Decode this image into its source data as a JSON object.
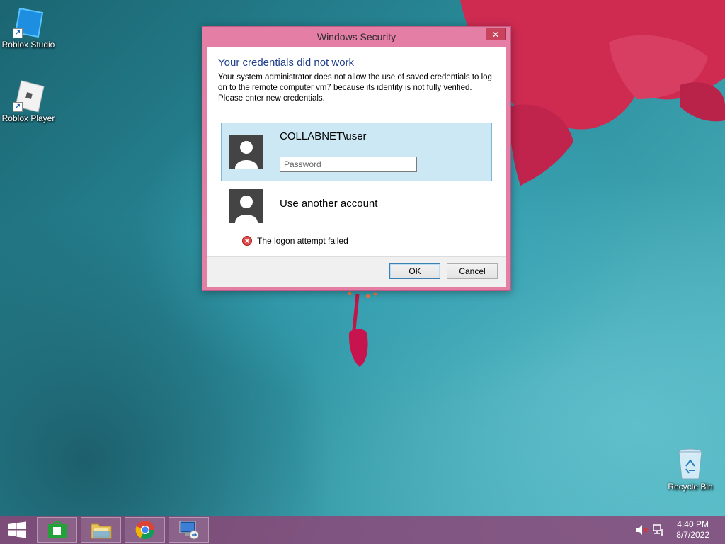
{
  "desktop": {
    "icons": [
      {
        "label": "Roblox Studio"
      },
      {
        "label": "Roblox Player"
      },
      {
        "label": "Recycle Bin"
      }
    ]
  },
  "dialog": {
    "title": "Windows Security",
    "close_label": "✕",
    "heading": "Your credentials did not work",
    "description": "Your system administrator does not allow the use of saved credentials to log on to the remote computer vm7 because its identity is not fully verified. Please enter new credentials.",
    "selected_account": "COLLABNET\\user",
    "password_placeholder": "Password",
    "other_account": "Use another account",
    "error_message": "The logon attempt failed",
    "ok_label": "OK",
    "cancel_label": "Cancel"
  },
  "taskbar": {
    "items": [
      "windows-store",
      "file-explorer",
      "chrome",
      "remote-desktop-connection"
    ],
    "time": "4:40 PM",
    "date": "8/7/2022"
  },
  "colors": {
    "dialog_frame": "#e57ea4",
    "heading": "#1f3f8c",
    "selected_tile": "#cce8f5",
    "taskbar": "#8c4678"
  }
}
